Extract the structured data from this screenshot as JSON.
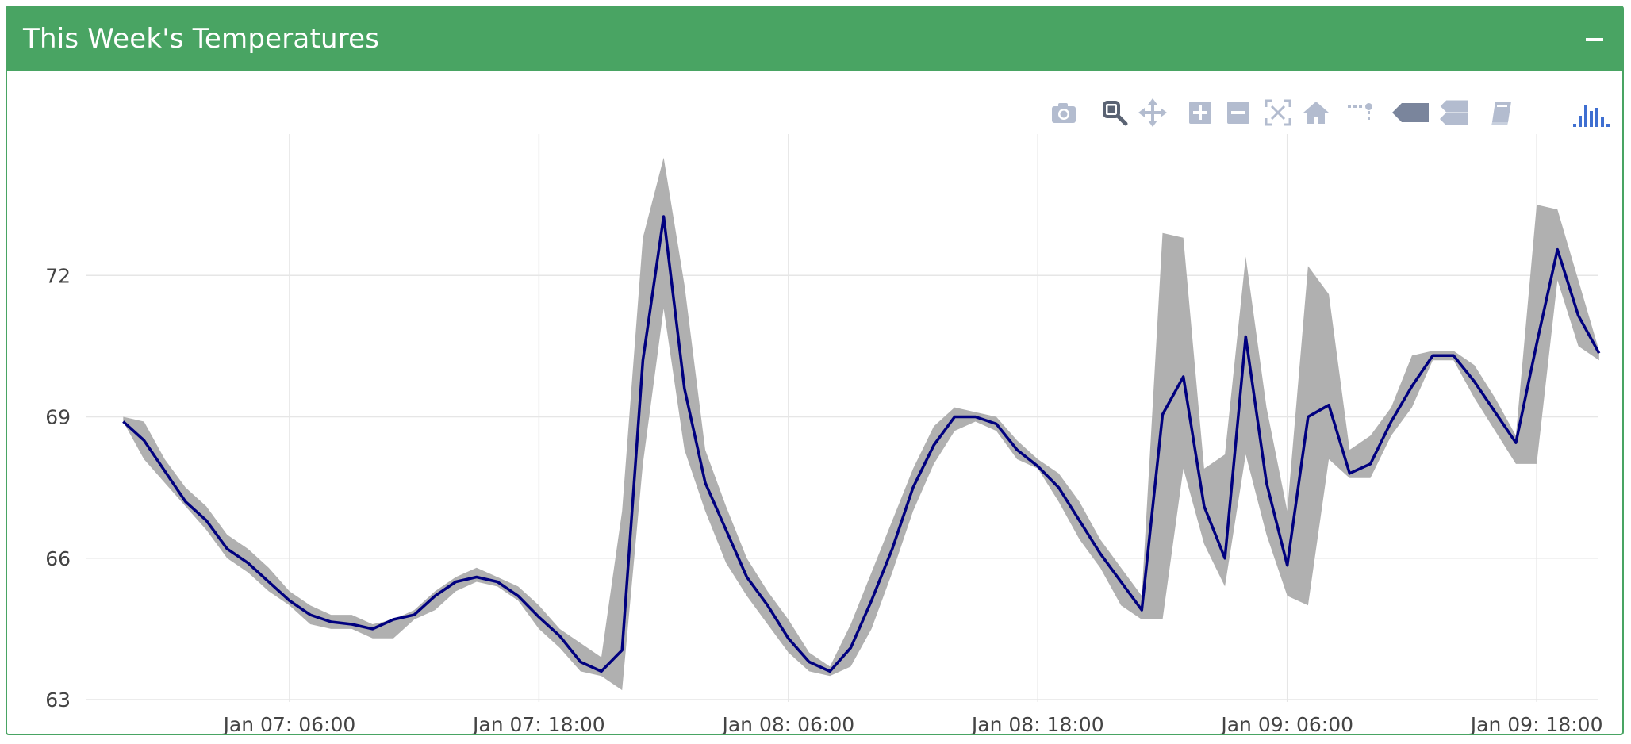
{
  "panel": {
    "title": "This Week's Temperatures",
    "header_color": "#49a463"
  },
  "modebar": {
    "buttons": [
      {
        "icon": "camera-icon"
      },
      {
        "icon": "zoom-icon"
      },
      {
        "icon": "pan-icon"
      },
      {
        "icon": "zoom-in-icon"
      },
      {
        "icon": "zoom-out-icon"
      },
      {
        "icon": "autoscale-icon"
      },
      {
        "icon": "reset-axes-icon"
      },
      {
        "icon": "spike-lines-icon"
      },
      {
        "icon": "hover-closest-icon"
      },
      {
        "icon": "hover-compare-icon"
      },
      {
        "icon": "book-icon"
      },
      {
        "icon": "plotly-logo-icon"
      }
    ]
  },
  "chart_data": {
    "type": "line",
    "title": "",
    "xlabel": "",
    "ylabel": "",
    "xlim": [
      "Jan 06, 20:14",
      "Jan 09, 20:56"
    ],
    "ylim": [
      62.95,
      75.0
    ],
    "yticks": [
      63,
      66,
      69,
      72
    ],
    "xticks": [
      "Jan 07: 06:00",
      "Jan 07: 18:00",
      "Jan 08: 06:00",
      "Jan 08: 18:00",
      "Jan 09: 06:00",
      "Jan 09: 18:00"
    ],
    "grid": true,
    "line_color": "#00007f",
    "band_color": "#b0b0b0",
    "x_start": "Jan 06, 22:00",
    "x_step_hours": 1,
    "series": [
      {
        "values": [
          68.9,
          68.5,
          67.85,
          67.2,
          66.8,
          66.2,
          65.9,
          65.5,
          65.1,
          64.8,
          64.65,
          64.6,
          64.5,
          64.7,
          64.8,
          65.2,
          65.5,
          65.6,
          65.5,
          65.2,
          64.75,
          64.35,
          63.8,
          63.6,
          64.05,
          70.2,
          73.25,
          69.6,
          67.6,
          66.6,
          65.6,
          65.0,
          64.3,
          63.8,
          63.6,
          64.1,
          65.1,
          66.2,
          67.5,
          68.4,
          69.0,
          69.0,
          68.85,
          68.3,
          67.95,
          67.5,
          66.8,
          66.1,
          65.5,
          64.9,
          69.05,
          69.85,
          67.1,
          66.0,
          70.7,
          67.6,
          65.85,
          69.0,
          69.25,
          67.8,
          68.0,
          68.9,
          69.65,
          70.3,
          70.3,
          69.75,
          69.1,
          68.45,
          70.55,
          72.55,
          71.15,
          70.35
        ]
      }
    ],
    "band": {
      "upper": [
        69.0,
        68.9,
        68.1,
        67.5,
        67.1,
        66.5,
        66.2,
        65.8,
        65.3,
        65.0,
        64.8,
        64.8,
        64.6,
        64.7,
        64.9,
        65.3,
        65.6,
        65.8,
        65.6,
        65.4,
        65.0,
        64.5,
        64.2,
        63.9,
        67.0,
        72.8,
        74.5,
        71.8,
        68.3,
        67.1,
        66.0,
        65.3,
        64.7,
        64.0,
        63.7,
        64.6,
        65.7,
        66.8,
        67.9,
        68.8,
        69.2,
        69.1,
        69.0,
        68.5,
        68.1,
        67.8,
        67.2,
        66.4,
        65.8,
        65.2,
        72.9,
        72.8,
        67.9,
        68.2,
        72.4,
        69.2,
        67.0,
        72.2,
        71.6,
        68.3,
        68.6,
        69.2,
        70.3,
        70.4,
        70.4,
        70.1,
        69.4,
        68.6,
        73.5,
        73.4,
        71.9,
        70.4
      ]
    },
    "band_lower": [
      68.9,
      68.1,
      67.6,
      67.1,
      66.6,
      66.0,
      65.7,
      65.3,
      65.0,
      64.6,
      64.5,
      64.5,
      64.3,
      64.3,
      64.7,
      64.9,
      65.3,
      65.5,
      65.4,
      65.1,
      64.5,
      64.1,
      63.6,
      63.5,
      63.2,
      68.0,
      71.3,
      68.3,
      67.0,
      65.9,
      65.2,
      64.6,
      64.0,
      63.6,
      63.5,
      63.7,
      64.5,
      65.7,
      67.0,
      68.0,
      68.7,
      68.9,
      68.7,
      68.1,
      67.9,
      67.2,
      66.4,
      65.8,
      65.0,
      64.7,
      64.7,
      67.9,
      66.3,
      65.4,
      68.2,
      66.5,
      65.2,
      65.0,
      68.1,
      67.7,
      67.7,
      68.6,
      69.2,
      70.2,
      70.2,
      69.4,
      68.7,
      68.0,
      68.0,
      71.9,
      70.5,
      70.2
    ]
  }
}
